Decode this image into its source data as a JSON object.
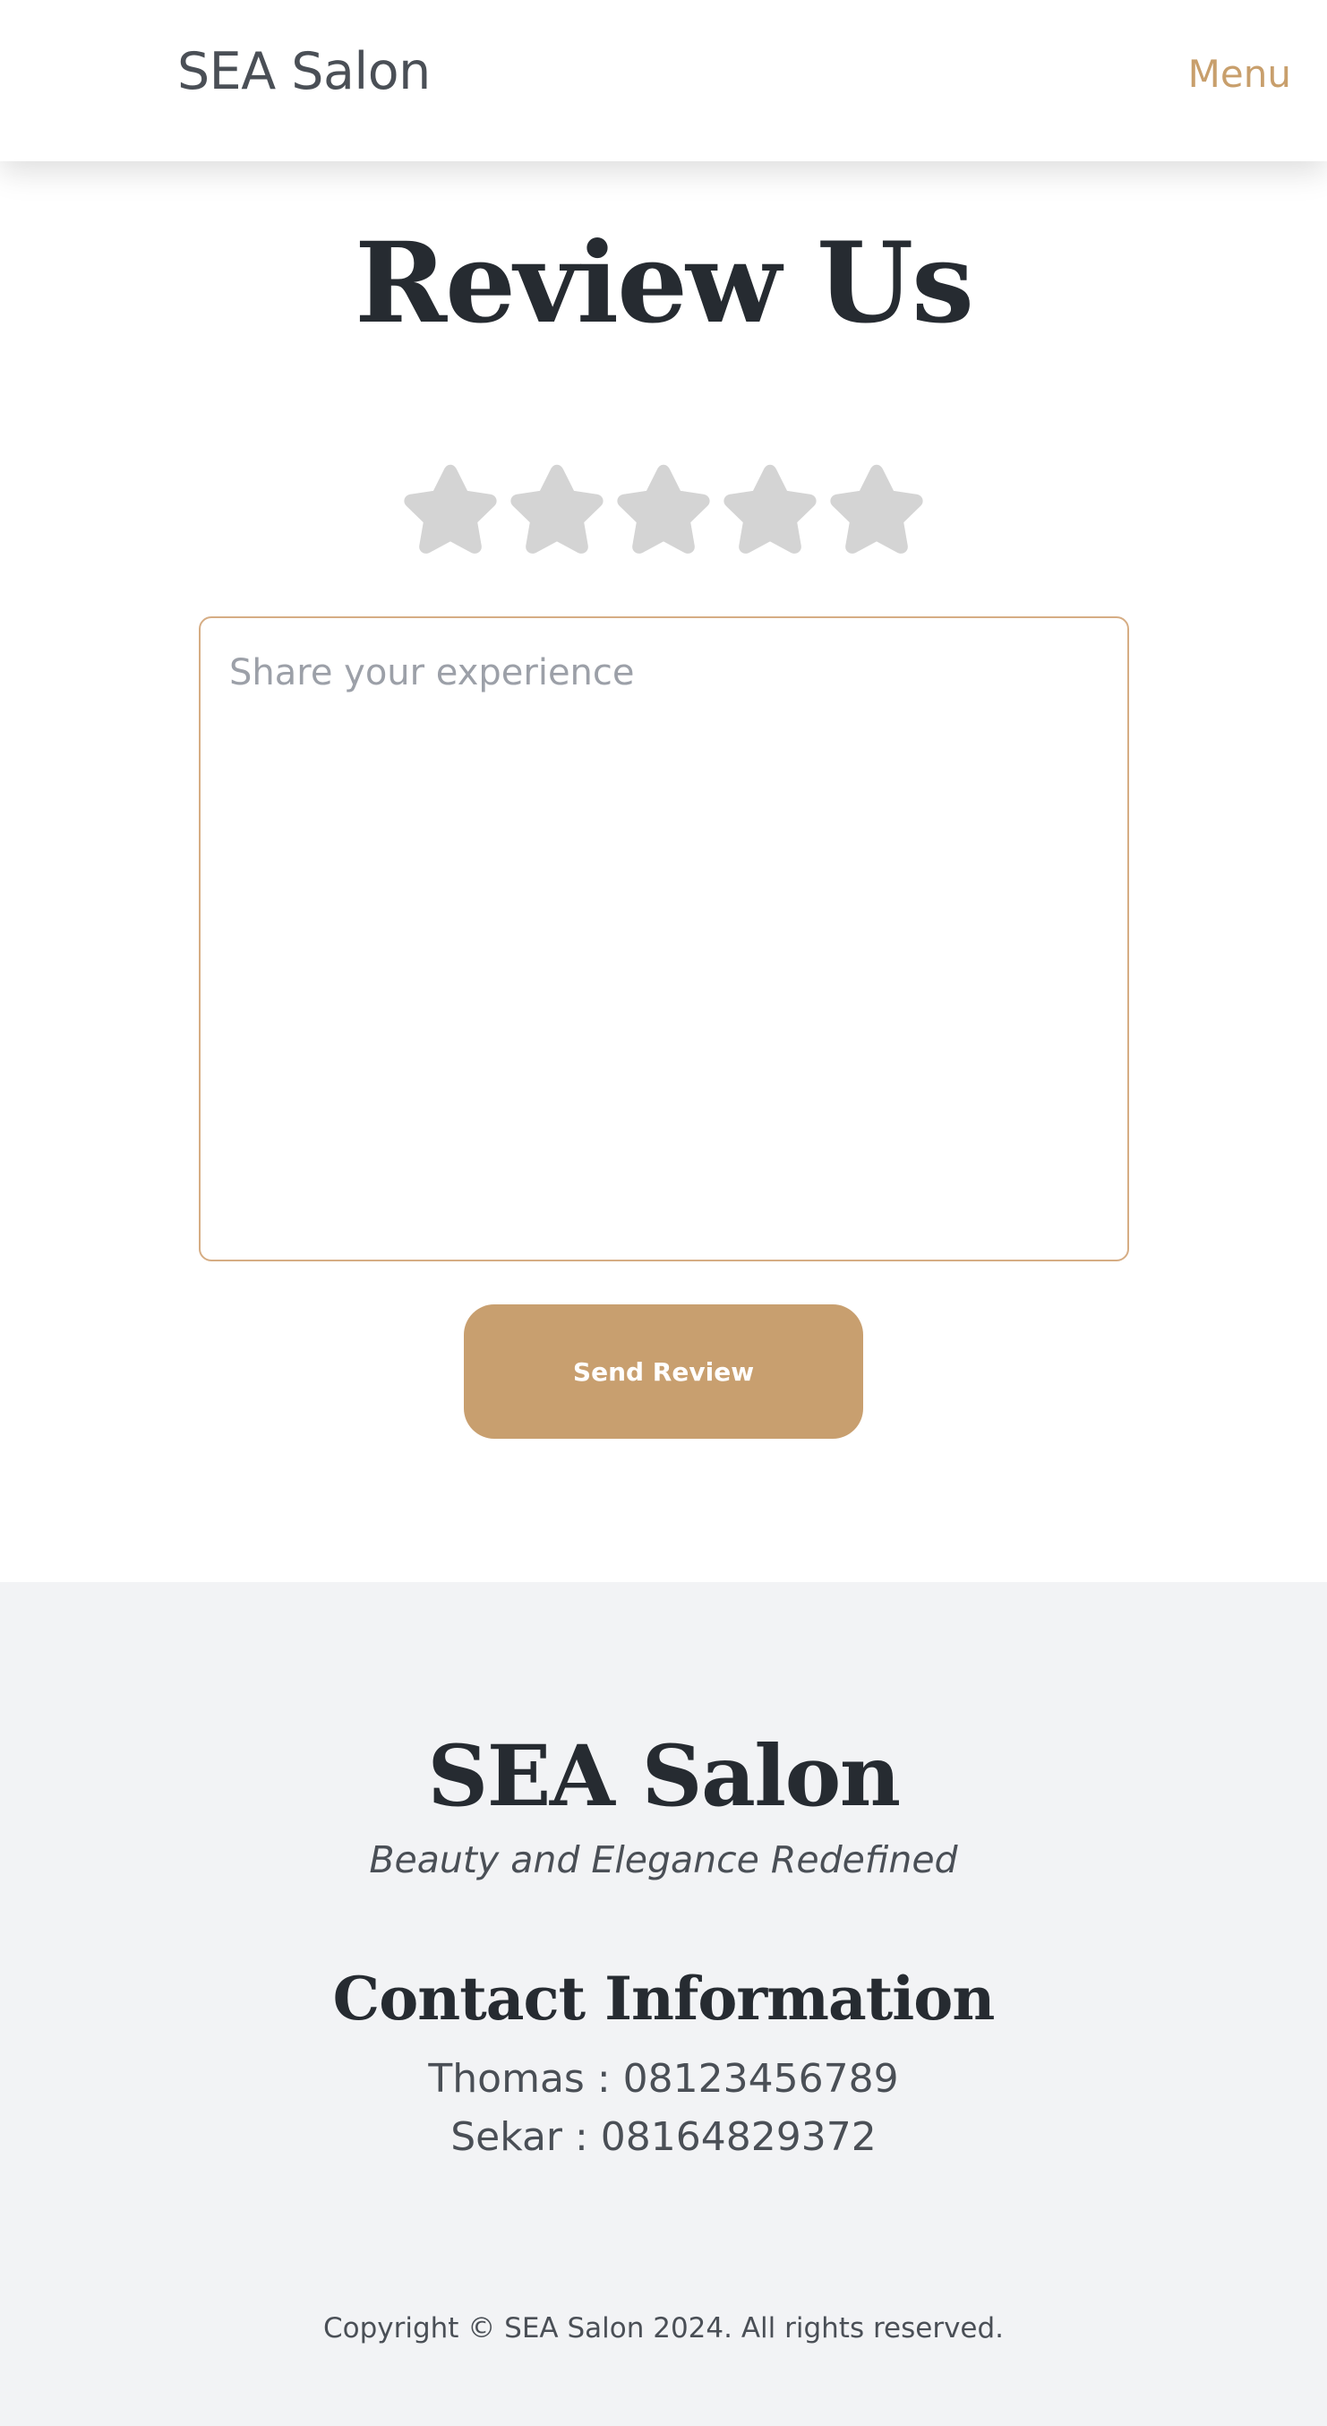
{
  "header": {
    "brand": "SEA Salon",
    "menu_label": "Menu"
  },
  "review": {
    "title": "Review Us",
    "rating": {
      "max_stars": 5,
      "selected": 0,
      "star_icon": "star-icon",
      "empty_color": "#d4d4d4"
    },
    "textarea": {
      "placeholder": "Share your experience",
      "value": ""
    },
    "send_label": "Send Review"
  },
  "footer": {
    "brand": "SEA Salon",
    "tagline": "Beauty and Elegance Redefined",
    "contact_title": "Contact Information",
    "contacts": [
      "Thomas : 08123456789",
      "Sekar : 08164829372"
    ],
    "copyright": "Copyright © SEA Salon 2024. All rights reserved."
  },
  "colors": {
    "accent": "#c89f6f",
    "heading": "#262b31",
    "body_text": "#4a4f56",
    "footer_bg": "#f2f3f5",
    "input_border": "#d6ad84"
  }
}
